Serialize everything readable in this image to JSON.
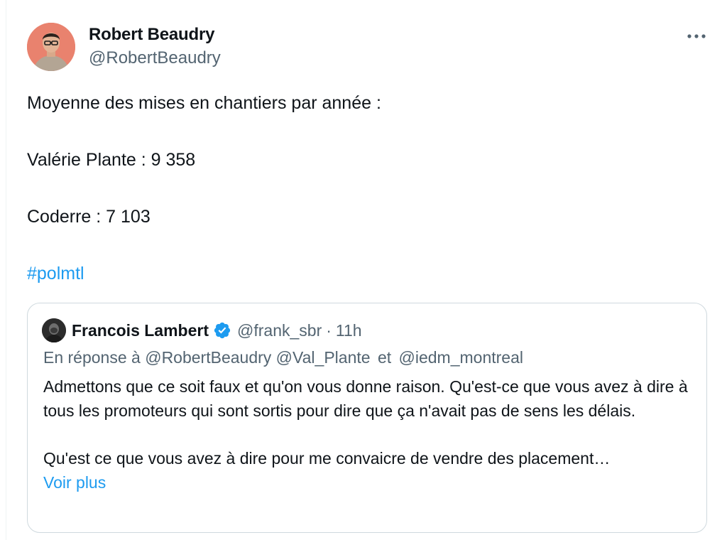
{
  "author": {
    "name": "Robert Beaudry",
    "handle": "@RobertBeaudry"
  },
  "post": {
    "lines": [
      "Moyenne des mises en chantiers par année :",
      "Valérie Plante : 9 358",
      "Coderre : 7 103"
    ],
    "hashtag": "#polmtl"
  },
  "quote": {
    "name": "Francois Lambert",
    "handle": "@frank_sbr",
    "separator": "·",
    "time": "11h",
    "reply_prefix": "En réponse à",
    "reply_mentions": "@RobertBeaudry @Val_Plante",
    "reply_and": "et",
    "reply_mention_last": "@iedm_montreal",
    "paragraph1": "Admettons que ce soit faux et qu'on vous donne raison. Qu'est-ce que vous avez à dire à tous les promoteurs qui sont sortis pour dire que ça n'avait pas de sens les délais.",
    "paragraph2": "Qu'est ce que vous avez à dire pour me convaicre de vendre des placement…",
    "show_more": "Voir plus"
  },
  "icons": {
    "more": "more-horizontal-icon",
    "verified": "verified-badge-icon"
  },
  "colors": {
    "accent": "#1d9bf0",
    "secondary_text": "#536471",
    "border": "#cfd9de"
  }
}
